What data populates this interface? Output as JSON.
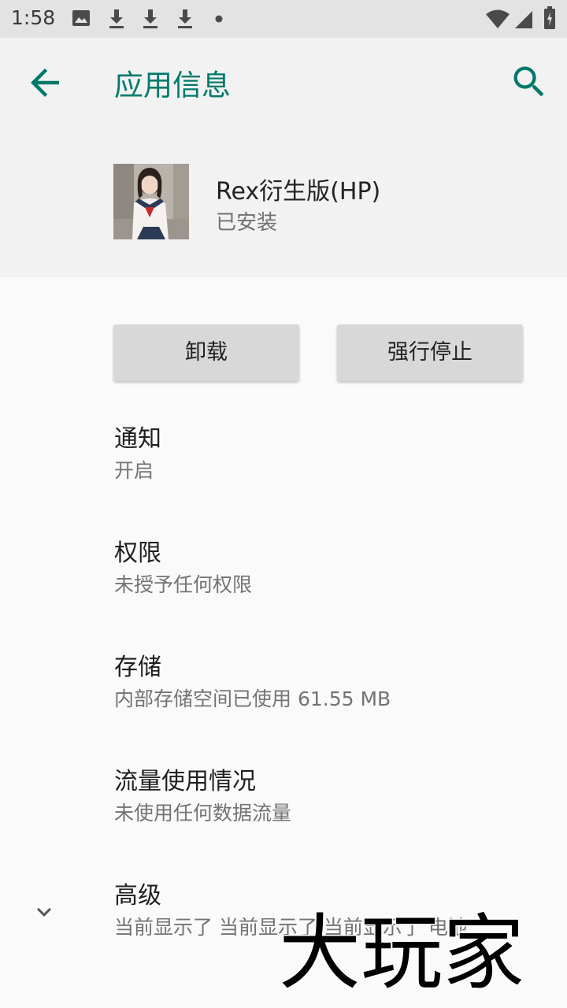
{
  "status_bar": {
    "time": "1:58",
    "icons": [
      "image-icon",
      "download-icon",
      "download-icon",
      "download-icon",
      "dot-icon",
      "wifi-icon",
      "signal-icon",
      "battery-icon"
    ]
  },
  "app_bar": {
    "back_icon": "arrow-left-icon",
    "title": "应用信息",
    "search_icon": "search-icon"
  },
  "app": {
    "name": "Rex衍生版(HP)",
    "status": "已安装"
  },
  "buttons": {
    "uninstall": "卸载",
    "force_stop": "强行停止"
  },
  "items": [
    {
      "title": "通知",
      "summary": "开启"
    },
    {
      "title": "权限",
      "summary": "未授予任何权限"
    },
    {
      "title": "存储",
      "summary": "内部存储空间已使用 61.55 MB"
    },
    {
      "title": "流量使用情况",
      "summary": "未使用任何数据流量"
    },
    {
      "title": "高级",
      "summary": "当前显示了 当前显示了 当前显示了 电池"
    }
  ],
  "watermark": "大玩家",
  "colors": {
    "accent": "#00796b",
    "status_bar": "#e3e3e3",
    "header_bg": "#f2f2f2",
    "page_bg": "#fafafa",
    "button_bg": "#d8d8d8"
  }
}
